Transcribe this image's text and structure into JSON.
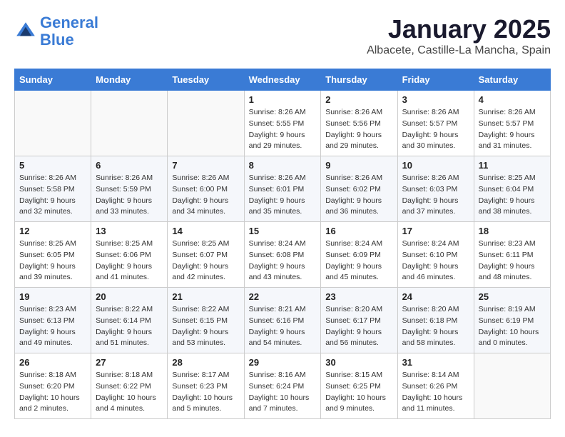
{
  "header": {
    "logo_line1": "General",
    "logo_line2": "Blue",
    "month": "January 2025",
    "location": "Albacete, Castille-La Mancha, Spain"
  },
  "weekdays": [
    "Sunday",
    "Monday",
    "Tuesday",
    "Wednesday",
    "Thursday",
    "Friday",
    "Saturday"
  ],
  "weeks": [
    [
      {
        "day": "",
        "info": ""
      },
      {
        "day": "",
        "info": ""
      },
      {
        "day": "",
        "info": ""
      },
      {
        "day": "1",
        "info": "Sunrise: 8:26 AM\nSunset: 5:55 PM\nDaylight: 9 hours\nand 29 minutes."
      },
      {
        "day": "2",
        "info": "Sunrise: 8:26 AM\nSunset: 5:56 PM\nDaylight: 9 hours\nand 29 minutes."
      },
      {
        "day": "3",
        "info": "Sunrise: 8:26 AM\nSunset: 5:57 PM\nDaylight: 9 hours\nand 30 minutes."
      },
      {
        "day": "4",
        "info": "Sunrise: 8:26 AM\nSunset: 5:57 PM\nDaylight: 9 hours\nand 31 minutes."
      }
    ],
    [
      {
        "day": "5",
        "info": "Sunrise: 8:26 AM\nSunset: 5:58 PM\nDaylight: 9 hours\nand 32 minutes."
      },
      {
        "day": "6",
        "info": "Sunrise: 8:26 AM\nSunset: 5:59 PM\nDaylight: 9 hours\nand 33 minutes."
      },
      {
        "day": "7",
        "info": "Sunrise: 8:26 AM\nSunset: 6:00 PM\nDaylight: 9 hours\nand 34 minutes."
      },
      {
        "day": "8",
        "info": "Sunrise: 8:26 AM\nSunset: 6:01 PM\nDaylight: 9 hours\nand 35 minutes."
      },
      {
        "day": "9",
        "info": "Sunrise: 8:26 AM\nSunset: 6:02 PM\nDaylight: 9 hours\nand 36 minutes."
      },
      {
        "day": "10",
        "info": "Sunrise: 8:26 AM\nSunset: 6:03 PM\nDaylight: 9 hours\nand 37 minutes."
      },
      {
        "day": "11",
        "info": "Sunrise: 8:25 AM\nSunset: 6:04 PM\nDaylight: 9 hours\nand 38 minutes."
      }
    ],
    [
      {
        "day": "12",
        "info": "Sunrise: 8:25 AM\nSunset: 6:05 PM\nDaylight: 9 hours\nand 39 minutes."
      },
      {
        "day": "13",
        "info": "Sunrise: 8:25 AM\nSunset: 6:06 PM\nDaylight: 9 hours\nand 41 minutes."
      },
      {
        "day": "14",
        "info": "Sunrise: 8:25 AM\nSunset: 6:07 PM\nDaylight: 9 hours\nand 42 minutes."
      },
      {
        "day": "15",
        "info": "Sunrise: 8:24 AM\nSunset: 6:08 PM\nDaylight: 9 hours\nand 43 minutes."
      },
      {
        "day": "16",
        "info": "Sunrise: 8:24 AM\nSunset: 6:09 PM\nDaylight: 9 hours\nand 45 minutes."
      },
      {
        "day": "17",
        "info": "Sunrise: 8:24 AM\nSunset: 6:10 PM\nDaylight: 9 hours\nand 46 minutes."
      },
      {
        "day": "18",
        "info": "Sunrise: 8:23 AM\nSunset: 6:11 PM\nDaylight: 9 hours\nand 48 minutes."
      }
    ],
    [
      {
        "day": "19",
        "info": "Sunrise: 8:23 AM\nSunset: 6:13 PM\nDaylight: 9 hours\nand 49 minutes."
      },
      {
        "day": "20",
        "info": "Sunrise: 8:22 AM\nSunset: 6:14 PM\nDaylight: 9 hours\nand 51 minutes."
      },
      {
        "day": "21",
        "info": "Sunrise: 8:22 AM\nSunset: 6:15 PM\nDaylight: 9 hours\nand 53 minutes."
      },
      {
        "day": "22",
        "info": "Sunrise: 8:21 AM\nSunset: 6:16 PM\nDaylight: 9 hours\nand 54 minutes."
      },
      {
        "day": "23",
        "info": "Sunrise: 8:20 AM\nSunset: 6:17 PM\nDaylight: 9 hours\nand 56 minutes."
      },
      {
        "day": "24",
        "info": "Sunrise: 8:20 AM\nSunset: 6:18 PM\nDaylight: 9 hours\nand 58 minutes."
      },
      {
        "day": "25",
        "info": "Sunrise: 8:19 AM\nSunset: 6:19 PM\nDaylight: 10 hours\nand 0 minutes."
      }
    ],
    [
      {
        "day": "26",
        "info": "Sunrise: 8:18 AM\nSunset: 6:20 PM\nDaylight: 10 hours\nand 2 minutes."
      },
      {
        "day": "27",
        "info": "Sunrise: 8:18 AM\nSunset: 6:22 PM\nDaylight: 10 hours\nand 4 minutes."
      },
      {
        "day": "28",
        "info": "Sunrise: 8:17 AM\nSunset: 6:23 PM\nDaylight: 10 hours\nand 5 minutes."
      },
      {
        "day": "29",
        "info": "Sunrise: 8:16 AM\nSunset: 6:24 PM\nDaylight: 10 hours\nand 7 minutes."
      },
      {
        "day": "30",
        "info": "Sunrise: 8:15 AM\nSunset: 6:25 PM\nDaylight: 10 hours\nand 9 minutes."
      },
      {
        "day": "31",
        "info": "Sunrise: 8:14 AM\nSunset: 6:26 PM\nDaylight: 10 hours\nand 11 minutes."
      },
      {
        "day": "",
        "info": ""
      }
    ]
  ]
}
